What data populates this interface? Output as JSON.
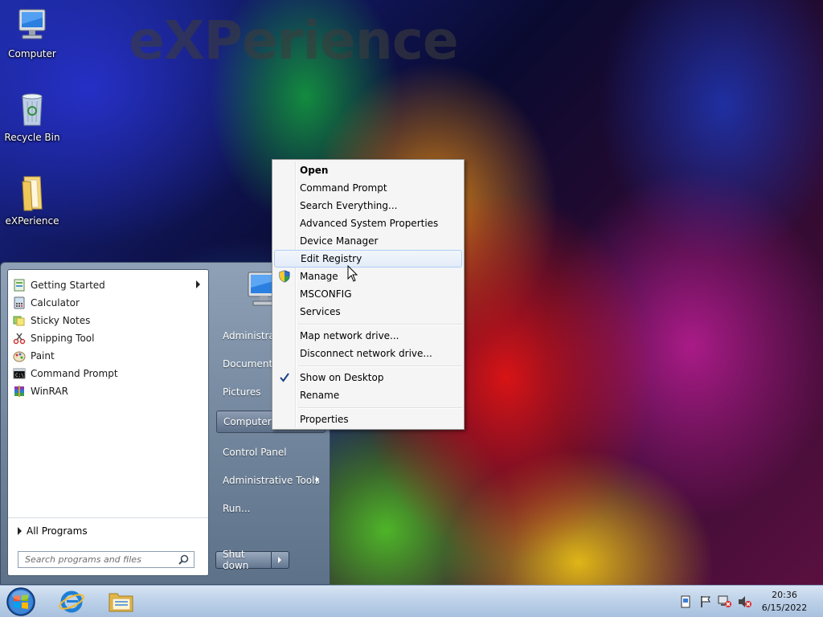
{
  "desktop": {
    "wallpaper_text": "eXPerience",
    "icons": [
      {
        "label": "Computer"
      },
      {
        "label": "Recycle Bin"
      },
      {
        "label": "eXPerience"
      }
    ]
  },
  "start_menu": {
    "programs": [
      {
        "label": "Getting Started",
        "icon": "getting-started-icon",
        "has_submenu": true
      },
      {
        "label": "Calculator",
        "icon": "calculator-icon"
      },
      {
        "label": "Sticky Notes",
        "icon": "sticky-notes-icon"
      },
      {
        "label": "Snipping Tool",
        "icon": "scissors-icon"
      },
      {
        "label": "Paint",
        "icon": "paint-icon"
      },
      {
        "label": "Command Prompt",
        "icon": "cmd-icon"
      },
      {
        "label": "WinRAR",
        "icon": "winrar-icon"
      }
    ],
    "all_programs": "All Programs",
    "search_placeholder": "Search programs and files",
    "right_items": [
      {
        "label": "Administrator"
      },
      {
        "label": "Documents"
      },
      {
        "label": "Pictures"
      },
      {
        "label": "Computer",
        "highlighted": true
      },
      {
        "label": "Control Panel"
      },
      {
        "label": "Administrative Tools",
        "has_submenu": true
      },
      {
        "label": "Run..."
      }
    ],
    "shutdown_label": "Shut down"
  },
  "context_menu": {
    "items": [
      {
        "label": "Open",
        "bold": true
      },
      {
        "label": "Command Prompt"
      },
      {
        "label": "Search Everything..."
      },
      {
        "label": "Advanced System Properties"
      },
      {
        "label": "Device Manager"
      },
      {
        "label": "Edit Registry",
        "hovered": true
      },
      {
        "label": "Manage",
        "icon": "uac-shield-icon"
      },
      {
        "label": "MSCONFIG"
      },
      {
        "label": "Services"
      },
      {
        "label": "Map network drive..."
      },
      {
        "label": "Disconnect network drive..."
      },
      {
        "label": "Show on Desktop",
        "checked": true
      },
      {
        "label": "Rename"
      },
      {
        "label": "Properties"
      }
    ]
  },
  "taskbar": {
    "pinned": [
      "internet-explorer-icon",
      "windows-explorer-icon"
    ],
    "tray": [
      "action-center-icon",
      "flag-icon",
      "network-icon",
      "volume-muted-icon"
    ],
    "time": "20:36",
    "date": "6/15/2022"
  },
  "colors": {
    "taskbar": "#bcd0e8",
    "start_menu": "#7a8ea6",
    "menu_hover": "#aecff7"
  }
}
